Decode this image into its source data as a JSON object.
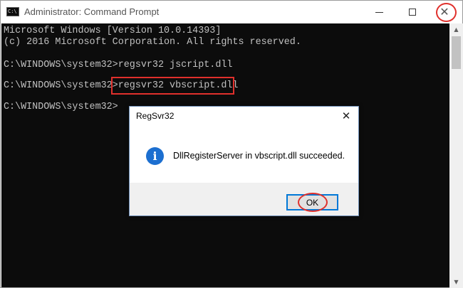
{
  "window": {
    "title": "Administrator: Command Prompt",
    "icon_name": "command-prompt-icon",
    "icon_text": "C:\\",
    "controls": [
      "minimize-icon",
      "maximize-icon",
      "close-icon"
    ],
    "close_glyph": "✕"
  },
  "console": {
    "lines": [
      "Microsoft Windows [Version 10.0.14393]",
      "(c) 2016 Microsoft Corporation. All rights reserved.",
      "",
      "C:\\WINDOWS\\system32>regsvr32 jscript.dll",
      "",
      "C:\\WINDOWS\\system32>regsvr32 vbscript.dll",
      "",
      "C:\\WINDOWS\\system32>"
    ],
    "text_color": "#c0c0c0",
    "background": "#0c0c0c"
  },
  "dialog": {
    "title": "RegSvr32",
    "close_glyph": "✕",
    "icon_name": "info-icon",
    "icon_glyph": "i",
    "message": "DllRegisterServer in vbscript.dll succeeded.",
    "ok_label": "OK"
  },
  "colors": {
    "highlight_red": "#e0302c",
    "accent_blue": "#0078d7",
    "info_blue": "#1c6fd0"
  }
}
